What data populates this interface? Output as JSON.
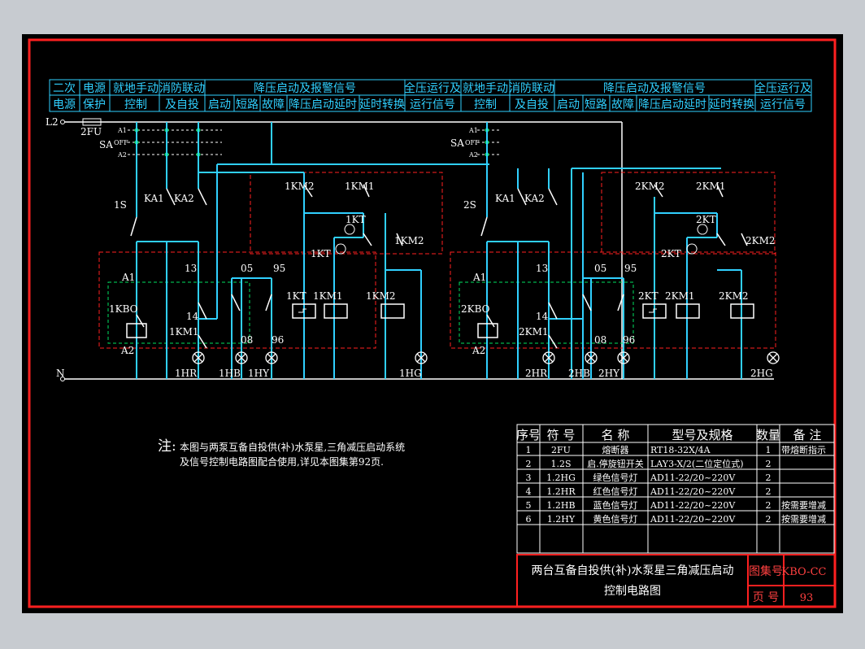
{
  "colors": {
    "background": "#c7cbd0",
    "paper": "#000000",
    "border": "#ff2020",
    "wire": "#30d0ff",
    "component": "#ffffff",
    "contact": "#00e060",
    "dashed": "#ff2020"
  },
  "header_cells_top": [
    "二次",
    "电源",
    "就地手动",
    "消防联动",
    "降压启动及报警信号",
    "全压运行及",
    "就地手动",
    "消防联动",
    "降压启动及报警信号",
    "全压运行及"
  ],
  "header_cells_bottom": [
    "电源",
    "保护",
    "控制",
    "及自投",
    "启动",
    "短路",
    "故障",
    "降压启动延时",
    "延时转换",
    "运行信号",
    "控制",
    "及自投",
    "启动",
    "短路",
    "故障",
    "降压启动延时",
    "延时转换",
    "运行信号"
  ],
  "bus": {
    "l2": "L2",
    "n": "N",
    "fuse": "2FU",
    "sa_left": "SA",
    "sa_right": "SA",
    "a1": "A1",
    "off": "OFF",
    "a2": "A2"
  },
  "unit1": {
    "s": "1S",
    "ka1": "KA1",
    "ka2": "KA2",
    "a1": "A1",
    "kbo": "1KBO",
    "a2": "A2",
    "n13": "13",
    "n14": "14",
    "km1_aux": "1KM1",
    "n05": "05",
    "n95": "95",
    "n08": "08",
    "n96": "96",
    "km2_top": "1KM2",
    "km1_top": "1KM1",
    "kt_top": "1KT",
    "km2_mid": "1KM2",
    "kt_mid": "1KT",
    "kt_coil": "1KT",
    "km1_coil": "1KM1",
    "km2_coil": "1KM2",
    "lamp_hr": "1HR",
    "lamp_hb": "1HB",
    "lamp_hy": "1HY",
    "lamp_hg": "1HG"
  },
  "unit2": {
    "s": "2S",
    "ka1": "KA1",
    "ka2": "KA2",
    "a1": "A1",
    "kbo": "2KBO",
    "a2": "A2",
    "n13": "13",
    "n14": "14",
    "km1_aux": "2KM1",
    "n05": "05",
    "n95": "95",
    "n08": "08",
    "n96": "96",
    "km2_top": "2KM2",
    "km1_top": "2KM1",
    "kt_top": "2KT",
    "km2_mid": "2KM2",
    "kt_mid": "2KT",
    "kt_coil": "2KT",
    "km1_coil": "2KM1",
    "km2_coil": "2KM2",
    "lamp_hr": "2HR",
    "lamp_hb": "2HB",
    "lamp_hy": "2HY",
    "lamp_hg": "2HG"
  },
  "note": {
    "label": "注:",
    "line1": "本图与两泵互备自投供(补)水泵星,三角减压启动系统",
    "line2": "及信号控制电路图配合使用,详见本图集第92页."
  },
  "parts_table": {
    "headers": [
      "序号",
      "符 号",
      "名 称",
      "型号及规格",
      "数量",
      "备 注"
    ],
    "rows": [
      [
        "1",
        "2FU",
        "熔断器",
        "RT18-32X/4A",
        "1",
        "带熔断指示"
      ],
      [
        "2",
        "1.2S",
        "启.停旋钮开关",
        "LAY3-X/2(二位定位式)",
        "2",
        ""
      ],
      [
        "3",
        "1.2HG",
        "绿色信号灯",
        "AD11-22/20~220V",
        "2",
        ""
      ],
      [
        "4",
        "1.2HR",
        "红色信号灯",
        "AD11-22/20~220V",
        "2",
        ""
      ],
      [
        "5",
        "1.2HB",
        "蓝色信号灯",
        "AD11-22/20~220V",
        "2",
        "按需要增减"
      ],
      [
        "6",
        "1.2HY",
        "黄色信号灯",
        "AD11-22/20~220V",
        "2",
        "按需要增减"
      ]
    ]
  },
  "title_block": {
    "title_line1": "两台互备自投供(补)水泵星三角减压启动",
    "title_line2": "控制电路图",
    "atlas_label": "图集号",
    "atlas_value": "KBO-CC",
    "page_label": "页 号",
    "page_value": "93"
  }
}
